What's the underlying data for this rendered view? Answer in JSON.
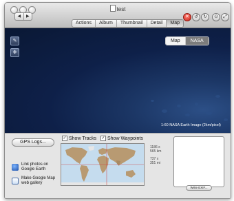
{
  "window": {
    "title": "test"
  },
  "toolbar": {
    "back_glyph": "◀",
    "forward_glyph": "▶",
    "tabs": [
      {
        "label": "Actions",
        "selected": false
      },
      {
        "label": "Album",
        "selected": false
      },
      {
        "label": "Thumbnail",
        "selected": false
      },
      {
        "label": "Detail",
        "selected": false
      },
      {
        "label": "Map",
        "selected": true
      }
    ],
    "right_buttons": [
      {
        "icon": "close-red-icon",
        "glyph": "✕"
      },
      {
        "icon": "rotate-left-icon",
        "glyph": "↺"
      },
      {
        "icon": "rotate-right-icon",
        "glyph": "↻"
      },
      {
        "icon": "settings-icon",
        "glyph": "⊙"
      },
      {
        "icon": "fullscreen-icon",
        "glyph": "⤢"
      }
    ]
  },
  "map": {
    "controls": [
      {
        "icon": "pan-tool-icon",
        "glyph": "✎"
      },
      {
        "icon": "zoom-control-icon",
        "glyph": "✥"
      }
    ],
    "mode_options": [
      "Map",
      "NASA"
    ],
    "selected_mode": "NASA",
    "scale_text": "1:60 NASA Earth Image (2km/pixel)",
    "ocean_color": "#0e2049"
  },
  "bottom": {
    "gps_button": "GPS Logs...",
    "show_tracks": {
      "label": "Show Tracks",
      "checked": true
    },
    "show_waypoints": {
      "label": "Show Waypoints",
      "checked": true
    },
    "dimensions_1": [
      "1186 x",
      "565 km"
    ],
    "dimensions_2": [
      "737 x",
      "351 mi"
    ],
    "link_google_earth": [
      "Link photos on",
      "Google Earth"
    ],
    "google_map_gallery": [
      "Make Google Map",
      "web gallery"
    ],
    "write_exif_button": "Write EXIF..."
  }
}
